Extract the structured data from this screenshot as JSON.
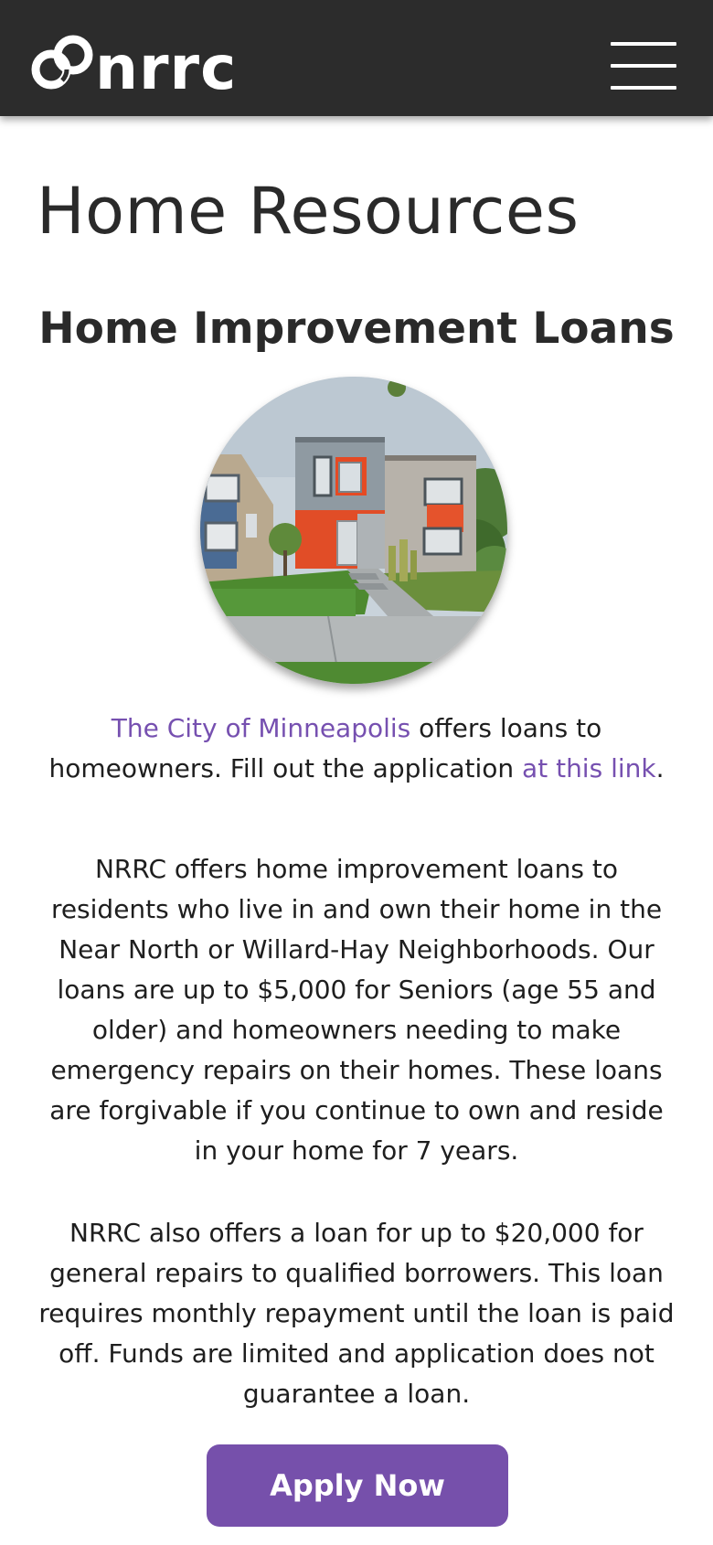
{
  "header": {
    "logo_text": "nrrc",
    "menu_icon": "hamburger-menu-icon"
  },
  "page": {
    "title": "Home Resources"
  },
  "section": {
    "title": "Home Improvement Loans",
    "image_icon": "house-photo"
  },
  "intro": {
    "link_city": "The City of Minneapolis",
    "text_1": " offers loans to homeowners. Fill out the application ",
    "link_application": "at this link",
    "text_2": "."
  },
  "paragraphs": {
    "forgivable": "NRRC offers home improvement loans to residents who live in and own their home in the Near North or Willard-Hay Neighborhoods. Our loans are up to $5,000 for Seniors (age 55 and older) and homeowners needing to make emergency repairs on their homes. These loans are forgivable if you continue to own and reside in your home for 7 years.",
    "general": "NRRC also offers a loan for up to $20,000 for general repairs to qualified borrowers. This loan requires monthly repayment until the loan is paid off. Funds are limited and application does not guarantee a loan."
  },
  "cta": {
    "apply_label": "Apply Now"
  },
  "colors": {
    "header_bg": "#2c2c2c",
    "link": "#7650b0",
    "button_bg": "#7650ab",
    "text": "#1e1e1e"
  }
}
